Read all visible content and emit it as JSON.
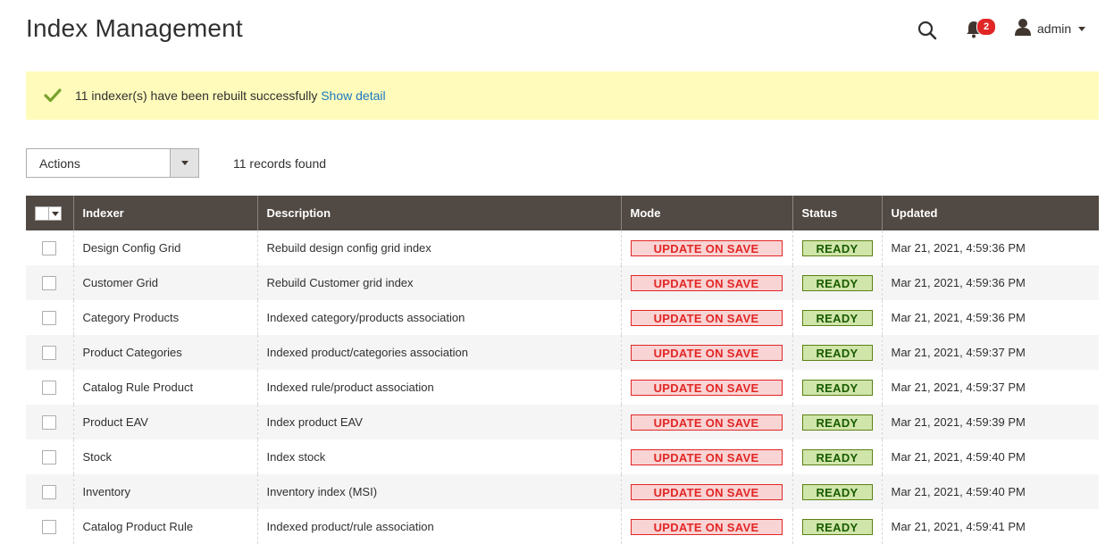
{
  "page": {
    "title": "Index Management"
  },
  "header": {
    "notification_count": "2",
    "user_name": "admin"
  },
  "message": {
    "text": "11 indexer(s) have been rebuilt successfully",
    "link": "Show detail"
  },
  "toolbar": {
    "actions_label": "Actions",
    "records_found": "11 records found"
  },
  "grid": {
    "columns": [
      "Indexer",
      "Description",
      "Mode",
      "Status",
      "Updated"
    ],
    "rows": [
      {
        "indexer": "Design Config Grid",
        "description": "Rebuild design config grid index",
        "mode": "UPDATE ON SAVE",
        "status": "READY",
        "updated": "Mar 21, 2021, 4:59:36 PM"
      },
      {
        "indexer": "Customer Grid",
        "description": "Rebuild Customer grid index",
        "mode": "UPDATE ON SAVE",
        "status": "READY",
        "updated": "Mar 21, 2021, 4:59:36 PM"
      },
      {
        "indexer": "Category Products",
        "description": "Indexed category/products association",
        "mode": "UPDATE ON SAVE",
        "status": "READY",
        "updated": "Mar 21, 2021, 4:59:36 PM"
      },
      {
        "indexer": "Product Categories",
        "description": "Indexed product/categories association",
        "mode": "UPDATE ON SAVE",
        "status": "READY",
        "updated": "Mar 21, 2021, 4:59:37 PM"
      },
      {
        "indexer": "Catalog Rule Product",
        "description": "Indexed rule/product association",
        "mode": "UPDATE ON SAVE",
        "status": "READY",
        "updated": "Mar 21, 2021, 4:59:37 PM"
      },
      {
        "indexer": "Product EAV",
        "description": "Index product EAV",
        "mode": "UPDATE ON SAVE",
        "status": "READY",
        "updated": "Mar 21, 2021, 4:59:39 PM"
      },
      {
        "indexer": "Stock",
        "description": "Index stock",
        "mode": "UPDATE ON SAVE",
        "status": "READY",
        "updated": "Mar 21, 2021, 4:59:40 PM"
      },
      {
        "indexer": "Inventory",
        "description": "Inventory index (MSI)",
        "mode": "UPDATE ON SAVE",
        "status": "READY",
        "updated": "Mar 21, 2021, 4:59:40 PM"
      },
      {
        "indexer": "Catalog Product Rule",
        "description": "Indexed product/rule association",
        "mode": "UPDATE ON SAVE",
        "status": "READY",
        "updated": "Mar 21, 2021, 4:59:41 PM"
      }
    ]
  },
  "colors": {
    "header_bg": "#514943",
    "message_bg": "#fffbbb",
    "link": "#1979c3",
    "mode_red": "#e22626",
    "status_green": "#185b00"
  }
}
